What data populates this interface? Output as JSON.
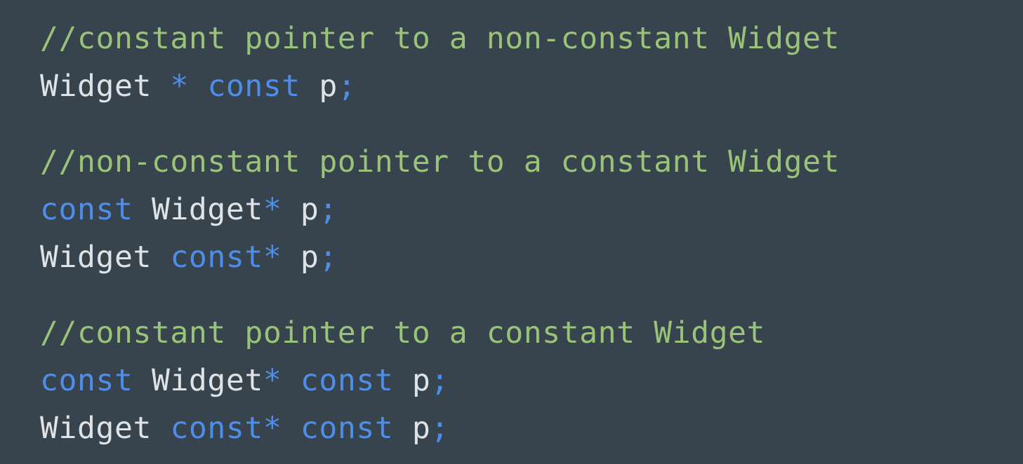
{
  "code": {
    "blocks": [
      {
        "comment": "//constant pointer to a non-constant Widget",
        "lines": [
          [
            {
              "text": "Widget",
              "kind": "identifier"
            },
            {
              "text": " ",
              "kind": "space"
            },
            {
              "text": "*",
              "kind": "operator"
            },
            {
              "text": " ",
              "kind": "space"
            },
            {
              "text": "const",
              "kind": "keyword"
            },
            {
              "text": " ",
              "kind": "space"
            },
            {
              "text": "p",
              "kind": "identifier"
            },
            {
              "text": ";",
              "kind": "punctuation"
            }
          ]
        ]
      },
      {
        "comment": "//non-constant pointer to a constant Widget",
        "lines": [
          [
            {
              "text": "const",
              "kind": "keyword"
            },
            {
              "text": " ",
              "kind": "space"
            },
            {
              "text": "Widget",
              "kind": "identifier"
            },
            {
              "text": "*",
              "kind": "operator"
            },
            {
              "text": " ",
              "kind": "space"
            },
            {
              "text": "p",
              "kind": "identifier"
            },
            {
              "text": ";",
              "kind": "punctuation"
            }
          ],
          [
            {
              "text": "Widget",
              "kind": "identifier"
            },
            {
              "text": " ",
              "kind": "space"
            },
            {
              "text": "const",
              "kind": "keyword"
            },
            {
              "text": "*",
              "kind": "operator"
            },
            {
              "text": " ",
              "kind": "space"
            },
            {
              "text": "p",
              "kind": "identifier"
            },
            {
              "text": ";",
              "kind": "punctuation"
            }
          ]
        ]
      },
      {
        "comment": "//constant pointer to a constant Widget",
        "lines": [
          [
            {
              "text": "const",
              "kind": "keyword"
            },
            {
              "text": " ",
              "kind": "space"
            },
            {
              "text": "Widget",
              "kind": "identifier"
            },
            {
              "text": "*",
              "kind": "operator"
            },
            {
              "text": " ",
              "kind": "space"
            },
            {
              "text": "const",
              "kind": "keyword"
            },
            {
              "text": " ",
              "kind": "space"
            },
            {
              "text": "p",
              "kind": "identifier"
            },
            {
              "text": ";",
              "kind": "punctuation"
            }
          ],
          [
            {
              "text": "Widget",
              "kind": "identifier"
            },
            {
              "text": " ",
              "kind": "space"
            },
            {
              "text": "const",
              "kind": "keyword"
            },
            {
              "text": "*",
              "kind": "operator"
            },
            {
              "text": " ",
              "kind": "space"
            },
            {
              "text": "const",
              "kind": "keyword"
            },
            {
              "text": " ",
              "kind": "space"
            },
            {
              "text": "p",
              "kind": "identifier"
            },
            {
              "text": ";",
              "kind": "punctuation"
            }
          ]
        ]
      }
    ]
  },
  "colors": {
    "background": "#37434d",
    "comment": "#98c379",
    "identifier": "#dfe3e6",
    "keyword": "#4e8ee8",
    "operator": "#4e8ee8",
    "punctuation": "#4e8ee8"
  }
}
